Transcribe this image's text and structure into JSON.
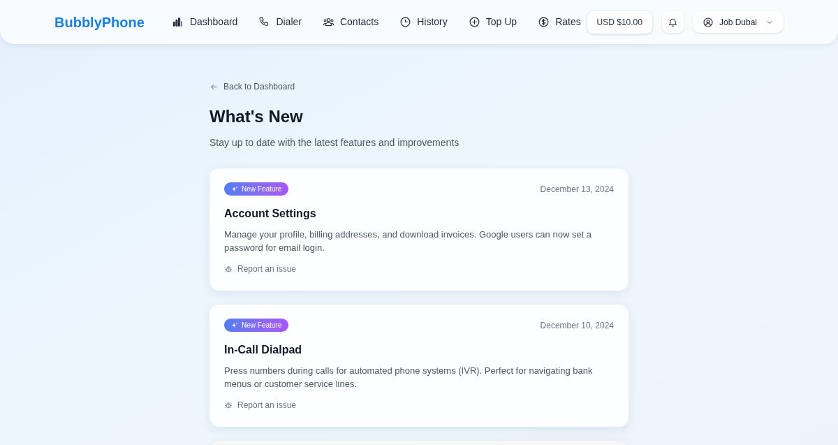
{
  "header": {
    "logo": "BubblyPhone",
    "nav": [
      {
        "label": "Dashboard",
        "kind": "chart",
        "selected": false
      },
      {
        "label": "Dialer",
        "kind": "phone",
        "selected": false
      },
      {
        "label": "Contacts",
        "kind": "people",
        "selected": false
      },
      {
        "label": "History",
        "kind": "clock",
        "selected": false
      },
      {
        "label": "Top Up",
        "kind": "plus",
        "selected": false
      },
      {
        "label": "Rates",
        "kind": "dollar",
        "selected": false
      }
    ],
    "balance": "USD $10.00",
    "user": "Job Dubai"
  },
  "back_link": "Back to Dashboard",
  "title": "What's New",
  "subtitle": "Stay up to date with the latest features and improvements",
  "cards": [
    {
      "kind": "entry",
      "badge": "New Feature",
      "date": "December 13, 2024",
      "title": "Account Settings",
      "description": "Manage your profile, billing addresses, and download invoices. Google users can now set a password for email login.",
      "report_link": "Report an issue"
    },
    {
      "kind": "entry",
      "badge": "New Feature",
      "date": "December 10, 2024",
      "title": "In-Call Dialpad",
      "description": "Press numbers during calls for automated phone systems (IVR). Perfect for navigating bank menus or customer service lines.",
      "report_link": "Report an issue"
    },
    {
      "kind": "cut-off"
    }
  ]
}
